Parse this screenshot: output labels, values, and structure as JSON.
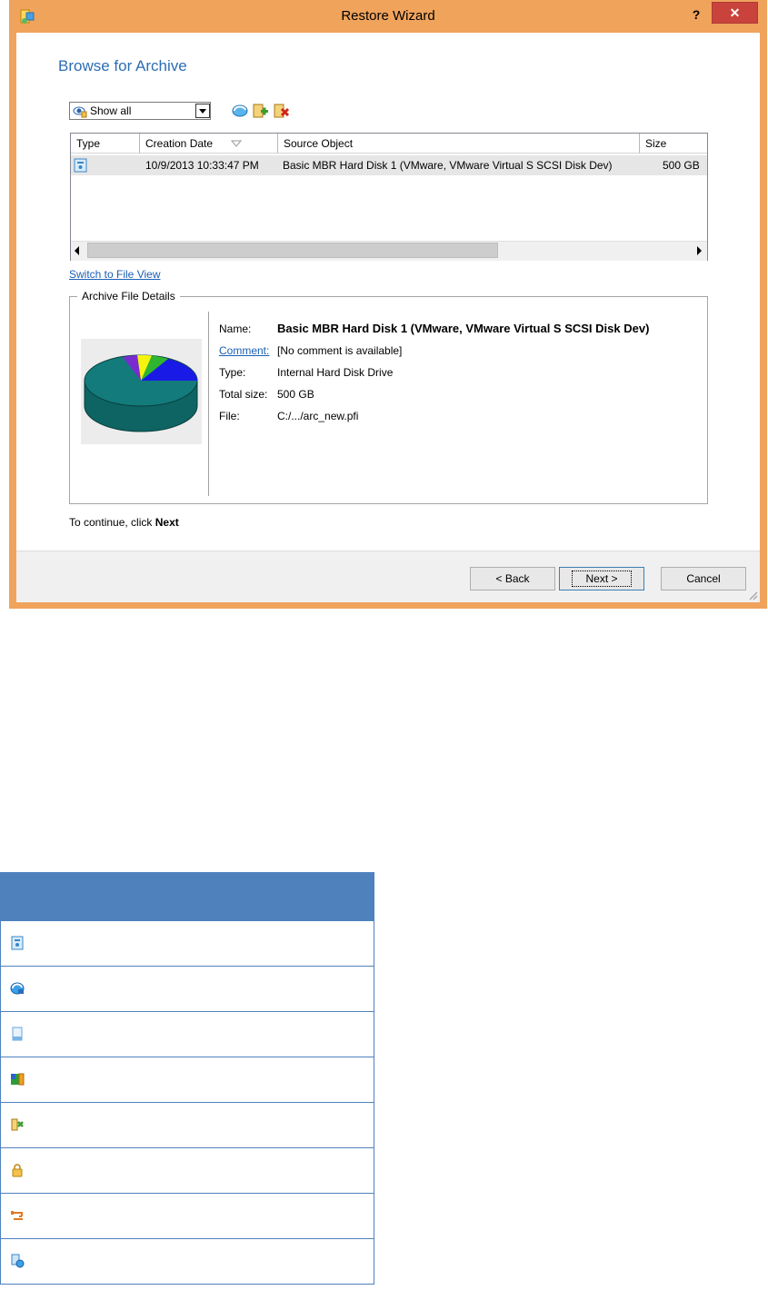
{
  "window": {
    "title": "Restore Wizard",
    "help_label": "?",
    "close_label": "✕",
    "frame_color": "#f0a35b"
  },
  "page": {
    "heading": "Browse for Archive"
  },
  "filter": {
    "selected": "Show all",
    "icons": [
      "refresh-icon",
      "add-archive-icon",
      "delete-archive-icon"
    ]
  },
  "list": {
    "columns": [
      "Type",
      "Creation Date",
      "Source Object",
      "Size"
    ],
    "sorted_column": "Creation Date",
    "rows": [
      {
        "type_icon": "hard-disk-icon",
        "creation_date": "10/9/2013 10:33:47 PM",
        "source_object": "Basic MBR Hard Disk 1 (VMware, VMware Virtual S SCSI Disk Dev)",
        "size": "500 GB"
      }
    ]
  },
  "switch_link": "Switch to File View",
  "details": {
    "group_title": "Archive File Details",
    "name_label": "Name:",
    "name_value": "Basic MBR Hard Disk 1 (VMware, VMware Virtual S SCSI Disk Dev)",
    "comment_label": "Comment:",
    "comment_value": "[No comment is available]",
    "type_label": "Type:",
    "type_value": "Internal Hard Disk Drive",
    "total_size_label": "Total size:",
    "total_size_value": "500 GB",
    "file_label": "File:",
    "file_value": "C:/.../arc_new.pfi"
  },
  "footer": {
    "continue_prefix": "To continue, click",
    "continue_bold": "Next"
  },
  "buttons": {
    "back": "< Back",
    "next": "Next >",
    "cancel": "Cancel"
  },
  "legend": {
    "header_color": "#4f81bd",
    "rows": [
      {
        "icon": "hard-disk-icon"
      },
      {
        "icon": "disk-refresh-icon"
      },
      {
        "icon": "file-icon"
      },
      {
        "icon": "image-archive-icon"
      },
      {
        "icon": "wizard-icon"
      },
      {
        "icon": "lock-icon"
      },
      {
        "icon": "link-icon"
      },
      {
        "icon": "restore-copy-icon"
      }
    ]
  }
}
